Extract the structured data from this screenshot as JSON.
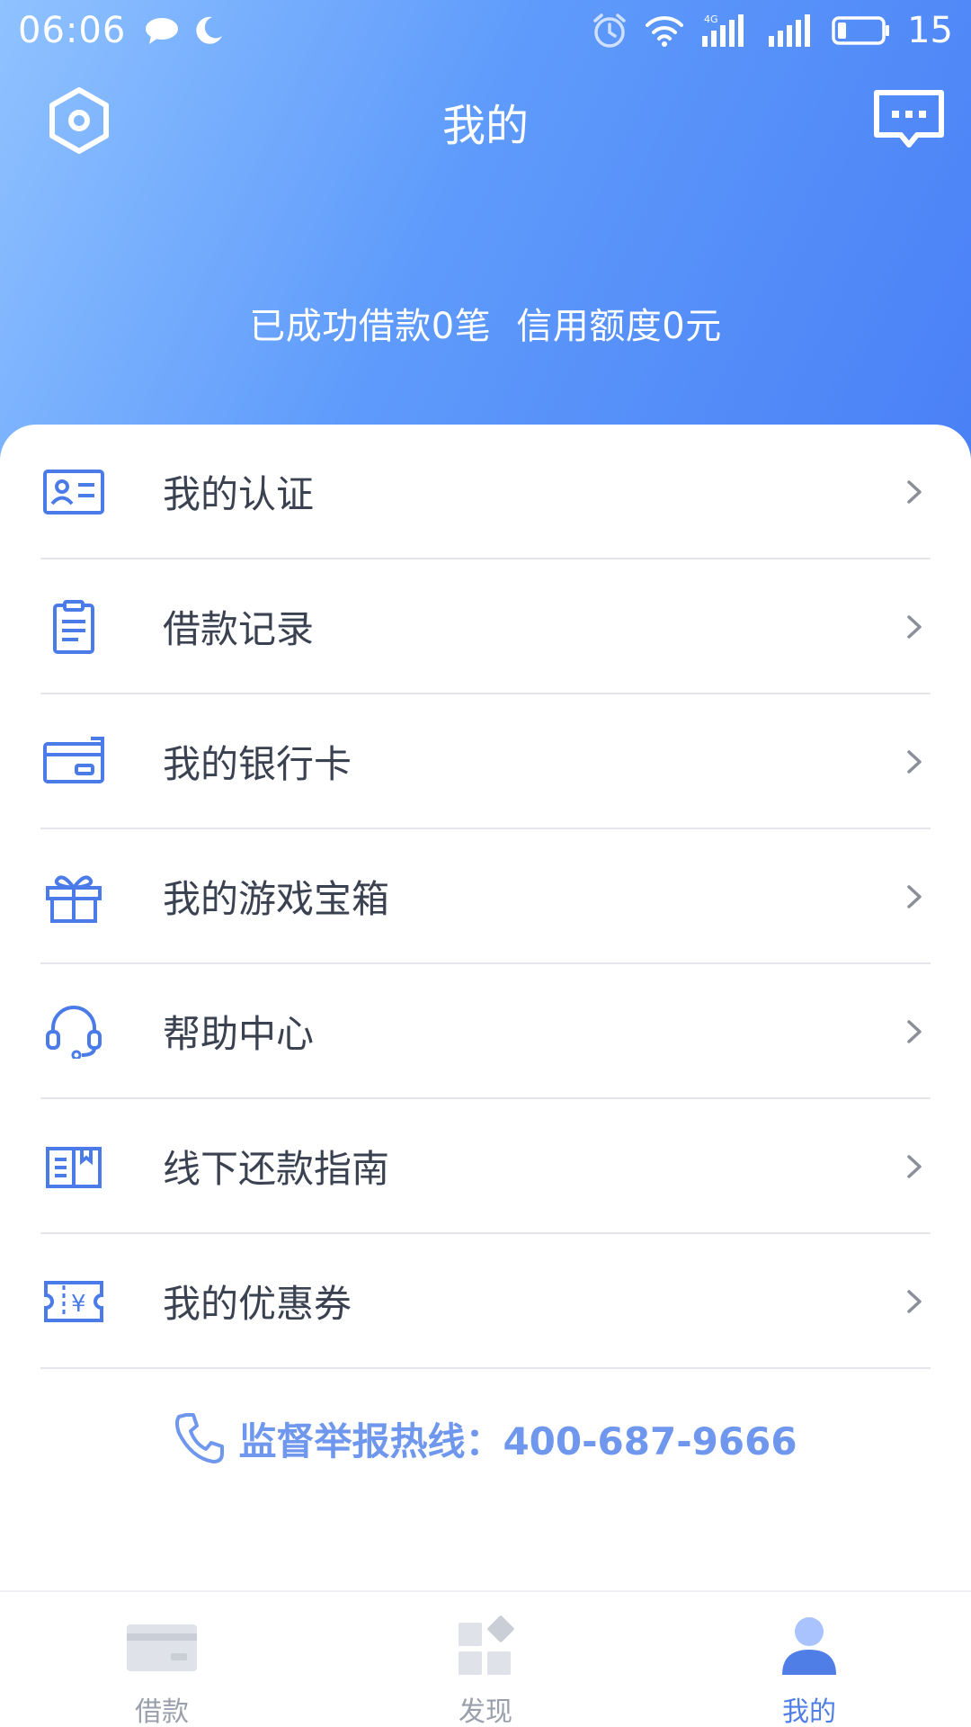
{
  "status_bar": {
    "time": "06:06",
    "battery_text": "15",
    "icons": [
      "chat-bubble-icon",
      "moon-icon",
      "alarm-icon",
      "wifi-icon",
      "signal-4g-icon",
      "signal-icon",
      "battery-icon"
    ]
  },
  "header": {
    "title": "我的",
    "left_icon": "settings-hexagon-icon",
    "right_icon": "message-icon",
    "stats": {
      "loans": "已成功借款0笔",
      "credit": "信用额度0元"
    }
  },
  "menu": {
    "items": [
      {
        "label": "我的认证",
        "icon": "id-card-icon"
      },
      {
        "label": "借款记录",
        "icon": "clipboard-icon"
      },
      {
        "label": "我的银行卡",
        "icon": "bank-card-icon"
      },
      {
        "label": "我的游戏宝箱",
        "icon": "gift-icon"
      },
      {
        "label": "帮助中心",
        "icon": "headset-icon"
      },
      {
        "label": "线下还款指南",
        "icon": "guide-book-icon"
      },
      {
        "label": "我的优惠券",
        "icon": "coupon-icon"
      }
    ]
  },
  "hotline": {
    "text": "监督举报热线：400-687-9666",
    "icon": "phone-icon"
  },
  "tab_bar": {
    "tabs": [
      {
        "label": "借款",
        "icon": "card-tab-icon",
        "active": false
      },
      {
        "label": "发现",
        "icon": "discover-tab-icon",
        "active": false
      },
      {
        "label": "我的",
        "icon": "user-tab-icon",
        "active": true
      }
    ]
  },
  "colors": {
    "accent": "#4f7fe6",
    "header_start": "#8fc2ff",
    "header_end": "#4a80f6",
    "icon_blue": "#4a7be8",
    "divider": "#e3e5ea",
    "inactive": "#9aa0ab"
  }
}
